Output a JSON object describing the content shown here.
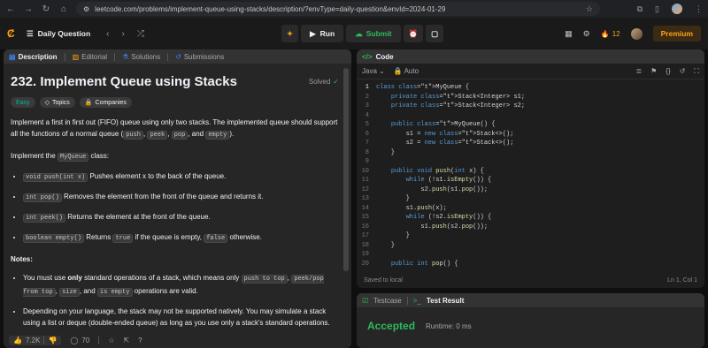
{
  "browser": {
    "url": "leetcode.com/problems/implement-queue-using-stacks/description/?envType=daily-question&envId=2024-01-29"
  },
  "navbar": {
    "daily_label": "Daily Question",
    "run_label": "Run",
    "submit_label": "Submit",
    "streak": "12",
    "premium_label": "Premium"
  },
  "left_tabs": {
    "description": "Description",
    "editorial": "Editorial",
    "solutions": "Solutions",
    "submissions": "Submissions"
  },
  "problem": {
    "title": "232. Implement Queue using Stacks",
    "solved": "Solved",
    "tags": {
      "difficulty": "Easy",
      "topics": "Topics",
      "companies": "Companies"
    },
    "intro_1": "Implement a first in first out (FIFO) queue using only two stacks. The implemented queue should support all the functions of a normal queue (",
    "intro_c1": "push",
    "intro_c2": "peek",
    "intro_c3": "pop",
    "intro_and": ", and ",
    "intro_c4": "empty",
    "intro_end": ").",
    "impl_prefix": "Implement the ",
    "impl_class": "MyQueue",
    "impl_suffix": " class:",
    "methods": [
      {
        "code": "void push(int x)",
        "text": " Pushes element x to the back of the queue."
      },
      {
        "code": "int pop()",
        "text": " Removes the element from the front of the queue and returns it."
      },
      {
        "code": "int peek()",
        "text": " Returns the element at the front of the queue."
      },
      {
        "code": "boolean empty()",
        "text": " Returns ",
        "code2": "true",
        "text2": " if the queue is empty, ",
        "code3": "false",
        "text3": " otherwise."
      }
    ],
    "notes_label": "Notes:",
    "note1_a": "You must use ",
    "note1_b": "only",
    "note1_c": " standard operations of a stack, which means only ",
    "note1_code1": "push to top",
    "note1_code2": "peek/pop from top",
    "note1_code3": "size",
    "note1_and": ", and ",
    "note1_code4": "is empty",
    "note1_end": " operations are valid.",
    "note2": "Depending on your language, the stack may not be supported natively. You may simulate a stack using a list or deque (double-ended queue) as long as you use only a stack's standard operations."
  },
  "bottom": {
    "likes": "7.2K",
    "comments": "70"
  },
  "code": {
    "tab_label": "Code",
    "language": "Java",
    "auto": "Auto",
    "saved": "Saved to local",
    "cursor": "Ln 1, Col 1",
    "lines": [
      "class MyQueue {",
      "    private Stack<Integer> s1;",
      "    private Stack<Integer> s2;",
      "",
      "    public MyQueue() {",
      "        s1 = new Stack<>();",
      "        s2 = new Stack<>();",
      "    }",
      "",
      "    public void push(int x) {",
      "        while (!s1.isEmpty()) {",
      "            s2.push(s1.pop());",
      "        }",
      "        s1.push(x);",
      "        while (!s2.isEmpty()) {",
      "            s1.push(s2.pop());",
      "        }",
      "    }",
      "",
      "    public int pop() {"
    ]
  },
  "result": {
    "testcase_label": "Testcase",
    "result_label": "Test Result",
    "status": "Accepted",
    "runtime": "Runtime: 0 ms"
  }
}
